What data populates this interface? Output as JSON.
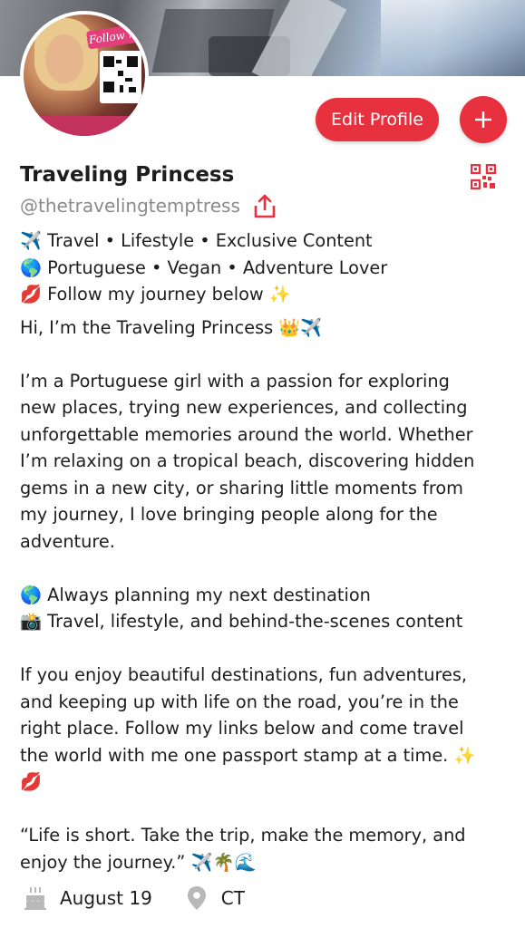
{
  "profile": {
    "name": "Traveling Princess",
    "handle": "@thetravelingtemptress",
    "edit_label": "Edit Profile",
    "add_label": "+",
    "avatar_badge": "Follow me"
  },
  "bio": {
    "tagline_1": "✈️ Travel • Lifestyle • Exclusive Content",
    "tagline_2": "🌎 Portuguese • Vegan • Adventure Lover",
    "tagline_3": "💋 Follow my journey below ✨",
    "intro": "Hi, I’m the Traveling Princess 👑✈️",
    "para1_l1": "I’m a Portuguese girl with a passion for exploring",
    "para1_l2": "new places, trying new experiences, and collecting",
    "para1_l3": "unforgettable memories around the world. Whether",
    "para1_l4": "I’m relaxing on a tropical beach, discovering hidden",
    "para1_l5": "gems in a new city, or sharing little moments from",
    "para1_l6": "my journey, I love bringing people along for the",
    "para1_l7": "adventure.",
    "point_1": "🌎 Always planning my next destination",
    "point_2": "📸 Travel, lifestyle, and behind-the-scenes content",
    "para2_l1": "If you enjoy beautiful destinations, fun adventures,",
    "para2_l2": "and keeping up with life on the road, you’re in the",
    "para2_l3": "right place. Follow my links below and come travel",
    "para2_l4": "the world with me one passport stamp at a time. ✨",
    "para2_l5": "💋",
    "quote_l1": "“Life is short. Take the trip, make the memory, and",
    "quote_l2": "enjoy the journey.” ✈️🌴🌊"
  },
  "meta": {
    "birthday": "August 19",
    "location": "CT"
  },
  "colors": {
    "accent": "#e8313f",
    "muted": "#8a8a8a",
    "icon_gray": "#b8b8b8"
  },
  "icons": [
    "qr-code-icon",
    "share-icon",
    "birthday-cake-icon",
    "location-pin-icon"
  ]
}
